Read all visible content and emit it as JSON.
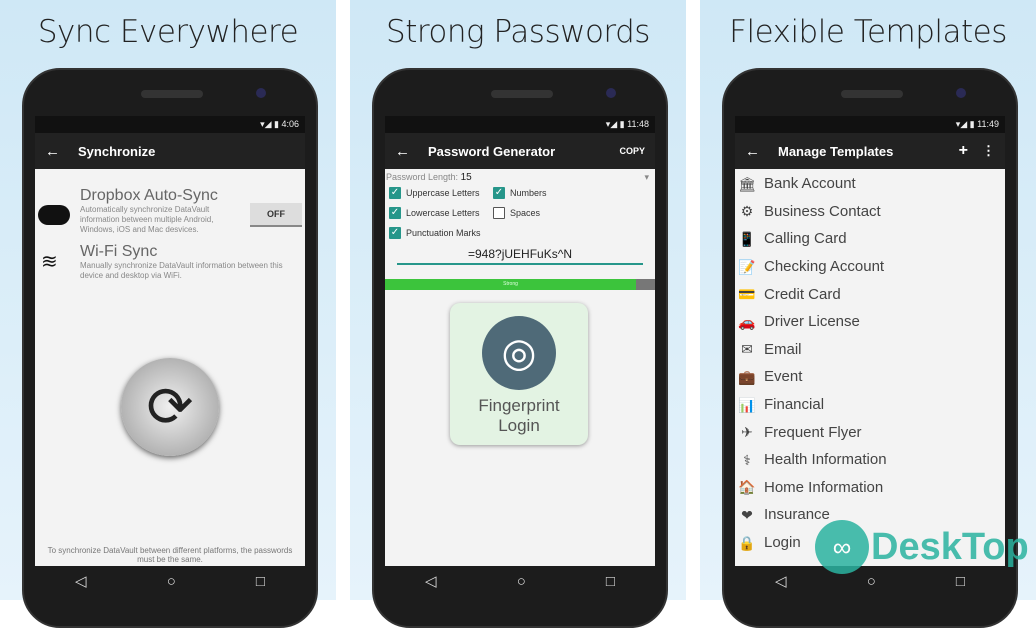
{
  "panels": [
    {
      "title": "Sync Everywhere",
      "time": "4:06",
      "appbar": "Synchronize",
      "dropbox": {
        "title": "Dropbox Auto-Sync",
        "desc": "Automatically synchronize DataVault information between multiple Android, Windows, iOS and Mac desvices.",
        "toggle": "OFF"
      },
      "wifi": {
        "title": "Wi-Fi Sync",
        "desc": "Manually synchronize DataVault information between this device and desktop via WiFi."
      },
      "footer": "To synchronize DataVault between different platforms, the passwords must be the same."
    },
    {
      "title": "Strong Passwords",
      "time": "11:48",
      "appbar": "Password Generator",
      "copy": "COPY",
      "length_label": "Password Length:",
      "length_value": "15",
      "options": [
        {
          "label": "Uppercase Letters",
          "checked": true
        },
        {
          "label": "Numbers",
          "checked": true
        },
        {
          "label": "Lowercase Letters",
          "checked": true
        },
        {
          "label": "Spaces",
          "checked": false
        },
        {
          "label": "Punctuation Marks",
          "checked": true
        }
      ],
      "password": "=948?jUEHFuKs^N",
      "strength_label": "Strong",
      "strength": 0.93,
      "fingerprint": {
        "line1": "Fingerprint",
        "line2": "Login"
      }
    },
    {
      "title": "Flexible Templates",
      "time": "11:49",
      "appbar": "Manage Templates",
      "templates": [
        {
          "label": "Bank Account",
          "icon": "🏛"
        },
        {
          "label": "Business Contact",
          "icon": "⚙"
        },
        {
          "label": "Calling Card",
          "icon": "📱"
        },
        {
          "label": "Checking Account",
          "icon": "📝"
        },
        {
          "label": "Credit Card",
          "icon": "💳"
        },
        {
          "label": "Driver License",
          "icon": "🚗"
        },
        {
          "label": "Email",
          "icon": "✉"
        },
        {
          "label": "Event",
          "icon": "💼"
        },
        {
          "label": "Financial",
          "icon": "📊"
        },
        {
          "label": "Frequent Flyer",
          "icon": "✈"
        },
        {
          "label": "Health Information",
          "icon": "⚕"
        },
        {
          "label": "Home Information",
          "icon": "🏠"
        },
        {
          "label": "Insurance",
          "icon": "❤"
        },
        {
          "label": "Login",
          "icon": "🔒"
        }
      ]
    }
  ],
  "watermark": "DeskTop",
  "colors": {
    "accent": "#26968a",
    "strength": "#3cc43c",
    "background": "#d6ecf8"
  }
}
